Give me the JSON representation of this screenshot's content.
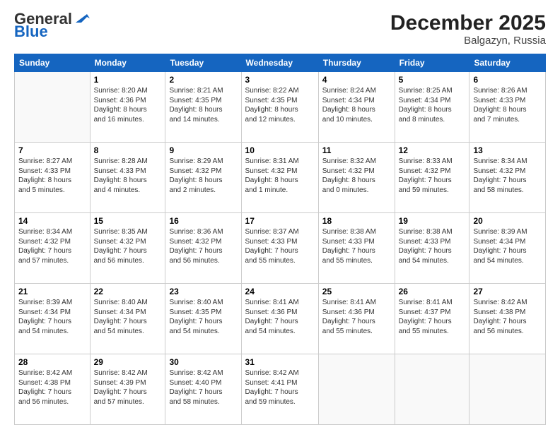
{
  "header": {
    "logo_general": "General",
    "logo_blue": "Blue",
    "month_title": "December 2025",
    "location": "Balgazyn, Russia"
  },
  "days_of_week": [
    "Sunday",
    "Monday",
    "Tuesday",
    "Wednesday",
    "Thursday",
    "Friday",
    "Saturday"
  ],
  "weeks": [
    [
      {
        "day": "",
        "info": ""
      },
      {
        "day": "1",
        "info": "Sunrise: 8:20 AM\nSunset: 4:36 PM\nDaylight: 8 hours\nand 16 minutes."
      },
      {
        "day": "2",
        "info": "Sunrise: 8:21 AM\nSunset: 4:35 PM\nDaylight: 8 hours\nand 14 minutes."
      },
      {
        "day": "3",
        "info": "Sunrise: 8:22 AM\nSunset: 4:35 PM\nDaylight: 8 hours\nand 12 minutes."
      },
      {
        "day": "4",
        "info": "Sunrise: 8:24 AM\nSunset: 4:34 PM\nDaylight: 8 hours\nand 10 minutes."
      },
      {
        "day": "5",
        "info": "Sunrise: 8:25 AM\nSunset: 4:34 PM\nDaylight: 8 hours\nand 8 minutes."
      },
      {
        "day": "6",
        "info": "Sunrise: 8:26 AM\nSunset: 4:33 PM\nDaylight: 8 hours\nand 7 minutes."
      }
    ],
    [
      {
        "day": "7",
        "info": "Sunrise: 8:27 AM\nSunset: 4:33 PM\nDaylight: 8 hours\nand 5 minutes."
      },
      {
        "day": "8",
        "info": "Sunrise: 8:28 AM\nSunset: 4:33 PM\nDaylight: 8 hours\nand 4 minutes."
      },
      {
        "day": "9",
        "info": "Sunrise: 8:29 AM\nSunset: 4:32 PM\nDaylight: 8 hours\nand 2 minutes."
      },
      {
        "day": "10",
        "info": "Sunrise: 8:31 AM\nSunset: 4:32 PM\nDaylight: 8 hours\nand 1 minute."
      },
      {
        "day": "11",
        "info": "Sunrise: 8:32 AM\nSunset: 4:32 PM\nDaylight: 8 hours\nand 0 minutes."
      },
      {
        "day": "12",
        "info": "Sunrise: 8:33 AM\nSunset: 4:32 PM\nDaylight: 7 hours\nand 59 minutes."
      },
      {
        "day": "13",
        "info": "Sunrise: 8:34 AM\nSunset: 4:32 PM\nDaylight: 7 hours\nand 58 minutes."
      }
    ],
    [
      {
        "day": "14",
        "info": "Sunrise: 8:34 AM\nSunset: 4:32 PM\nDaylight: 7 hours\nand 57 minutes."
      },
      {
        "day": "15",
        "info": "Sunrise: 8:35 AM\nSunset: 4:32 PM\nDaylight: 7 hours\nand 56 minutes."
      },
      {
        "day": "16",
        "info": "Sunrise: 8:36 AM\nSunset: 4:32 PM\nDaylight: 7 hours\nand 56 minutes."
      },
      {
        "day": "17",
        "info": "Sunrise: 8:37 AM\nSunset: 4:33 PM\nDaylight: 7 hours\nand 55 minutes."
      },
      {
        "day": "18",
        "info": "Sunrise: 8:38 AM\nSunset: 4:33 PM\nDaylight: 7 hours\nand 55 minutes."
      },
      {
        "day": "19",
        "info": "Sunrise: 8:38 AM\nSunset: 4:33 PM\nDaylight: 7 hours\nand 54 minutes."
      },
      {
        "day": "20",
        "info": "Sunrise: 8:39 AM\nSunset: 4:34 PM\nDaylight: 7 hours\nand 54 minutes."
      }
    ],
    [
      {
        "day": "21",
        "info": "Sunrise: 8:39 AM\nSunset: 4:34 PM\nDaylight: 7 hours\nand 54 minutes."
      },
      {
        "day": "22",
        "info": "Sunrise: 8:40 AM\nSunset: 4:34 PM\nDaylight: 7 hours\nand 54 minutes."
      },
      {
        "day": "23",
        "info": "Sunrise: 8:40 AM\nSunset: 4:35 PM\nDaylight: 7 hours\nand 54 minutes."
      },
      {
        "day": "24",
        "info": "Sunrise: 8:41 AM\nSunset: 4:36 PM\nDaylight: 7 hours\nand 54 minutes."
      },
      {
        "day": "25",
        "info": "Sunrise: 8:41 AM\nSunset: 4:36 PM\nDaylight: 7 hours\nand 55 minutes."
      },
      {
        "day": "26",
        "info": "Sunrise: 8:41 AM\nSunset: 4:37 PM\nDaylight: 7 hours\nand 55 minutes."
      },
      {
        "day": "27",
        "info": "Sunrise: 8:42 AM\nSunset: 4:38 PM\nDaylight: 7 hours\nand 56 minutes."
      }
    ],
    [
      {
        "day": "28",
        "info": "Sunrise: 8:42 AM\nSunset: 4:38 PM\nDaylight: 7 hours\nand 56 minutes."
      },
      {
        "day": "29",
        "info": "Sunrise: 8:42 AM\nSunset: 4:39 PM\nDaylight: 7 hours\nand 57 minutes."
      },
      {
        "day": "30",
        "info": "Sunrise: 8:42 AM\nSunset: 4:40 PM\nDaylight: 7 hours\nand 58 minutes."
      },
      {
        "day": "31",
        "info": "Sunrise: 8:42 AM\nSunset: 4:41 PM\nDaylight: 7 hours\nand 59 minutes."
      },
      {
        "day": "",
        "info": ""
      },
      {
        "day": "",
        "info": ""
      },
      {
        "day": "",
        "info": ""
      }
    ]
  ]
}
